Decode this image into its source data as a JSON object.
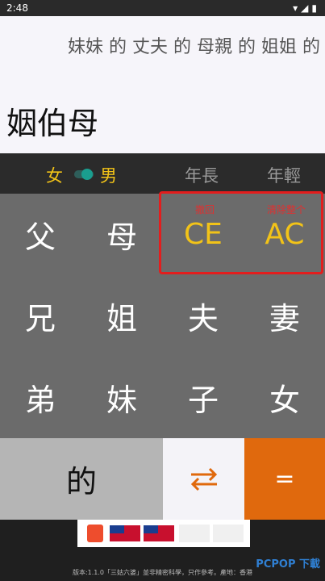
{
  "status": {
    "time": "2:48",
    "icons": [
      "wifi-icon",
      "signal-icon",
      "battery-icon"
    ]
  },
  "display": {
    "expression": "妹妹 的 丈夫 的 母親 的 姐姐 的",
    "result": "姻伯母"
  },
  "modes": {
    "female": "女",
    "male": "男",
    "older": "年長",
    "younger": "年輕"
  },
  "keys": {
    "father": "父",
    "mother": "母",
    "ce": "CE",
    "ac": "AC",
    "ce_hint": "撤回",
    "ac_hint": "清除整个",
    "brother": "兄",
    "sister": "姐",
    "husband": "夫",
    "wife": "妻",
    "younger_brother": "弟",
    "younger_sister": "妹",
    "son": "子",
    "daughter": "女",
    "of": "的",
    "equals": "="
  },
  "footer": {
    "text": "版本:1.1.0「三姑六婆」並非精密科學，只作參考。產地：香港",
    "logo": "PCPOP 下載"
  },
  "colors": {
    "accent_yellow": "#f2c318",
    "orange": "#e0690d",
    "red_box": "#e31d1d"
  }
}
